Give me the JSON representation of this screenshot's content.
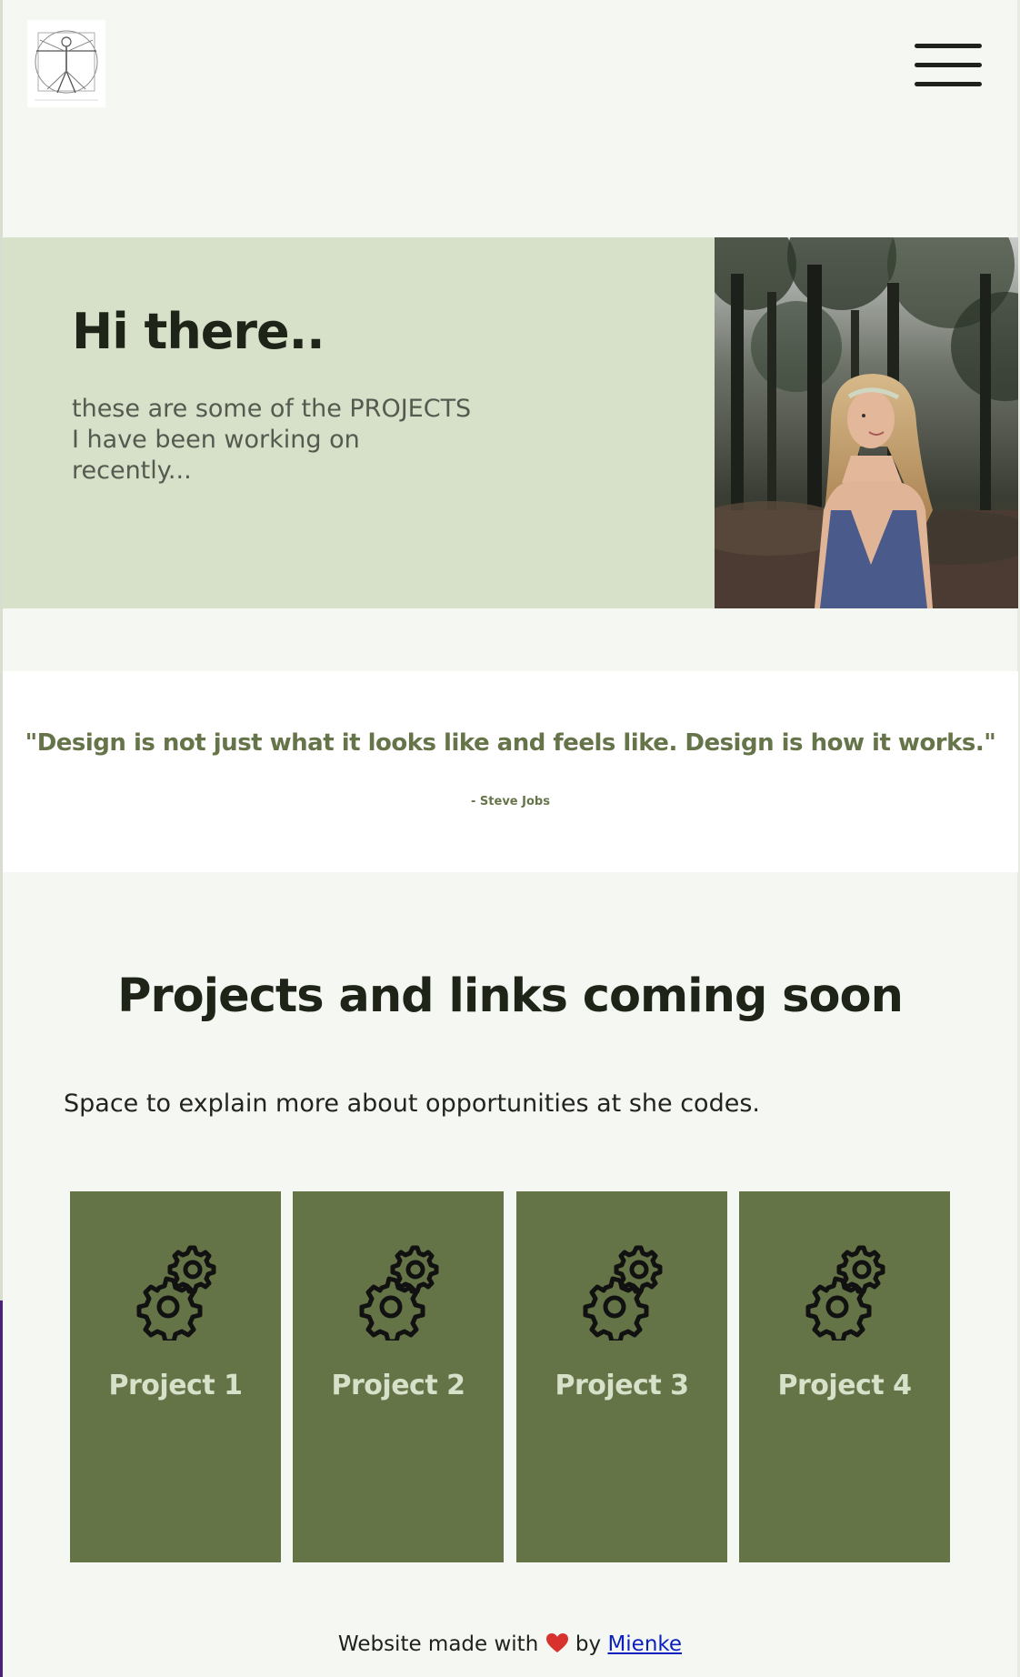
{
  "header": {
    "logo_name": "vitruvian-man-logo",
    "menu_icon": "hamburger-icon"
  },
  "hero": {
    "title": "Hi there..",
    "text": "these are some of the PROJECTS I have been working on recently..."
  },
  "quote": {
    "text": "\"Design is not just what it looks like and feels like. Design is how it works.\"",
    "author": "- Steve Jobs"
  },
  "projects": {
    "title": "Projects and links coming soon",
    "description": "Space to explain more about opportunities at she codes.",
    "cards": [
      {
        "label": "Project 1",
        "icon": "gears-icon"
      },
      {
        "label": "Project 2",
        "icon": "gears-icon"
      },
      {
        "label": "Project 3",
        "icon": "gears-icon"
      },
      {
        "label": "Project 4",
        "icon": "gears-icon"
      }
    ]
  },
  "footer": {
    "prefix": "Website made with",
    "by": "by",
    "author_link": "Mienke",
    "heart_icon": "heart-icon"
  },
  "colors": {
    "page_bg": "#f5f8f2",
    "hero_bg": "#d7e0c8",
    "accent_green": "#657447",
    "text_dark": "#1f2419"
  }
}
